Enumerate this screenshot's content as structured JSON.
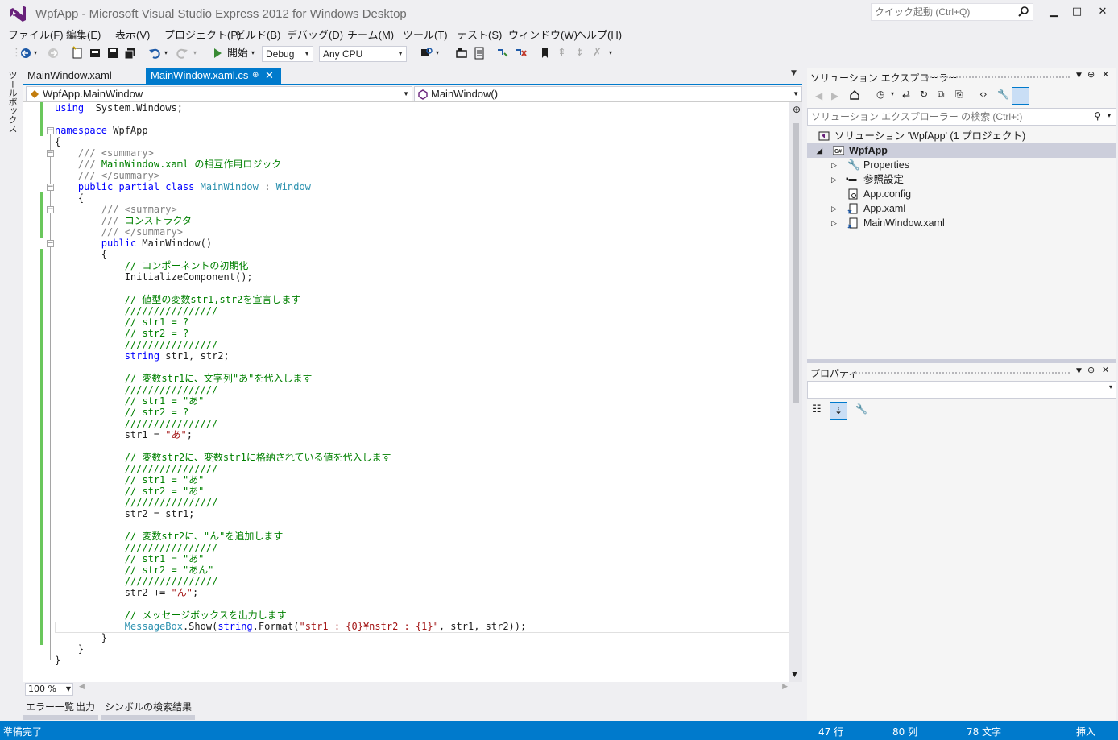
{
  "window": {
    "title": "WpfApp - Microsoft Visual Studio Express 2012 for Windows Desktop",
    "quick_launch_placeholder": "クイック起動 (Ctrl+Q)",
    "minimize": "▁",
    "maximize": "□",
    "close": "✕"
  },
  "menu": [
    "ファイル(F)",
    "編集(E)",
    "表示(V)",
    "プロジェクト(P)",
    "ビルド(B)",
    "デバッグ(D)",
    "チーム(M)",
    "ツール(T)",
    "テスト(S)",
    "ウィンドウ(W)",
    "ヘルプ(H)"
  ],
  "toolbar": {
    "start_label": "開始",
    "config": "Debug",
    "platform": "Any CPU"
  },
  "toolbox_label": "ツールボックス",
  "tabs": {
    "xaml": "MainWindow.xaml",
    "cs": "MainWindow.xaml.cs",
    "pin": "⊕",
    "close": "✕"
  },
  "nav": {
    "type": "WpfApp.MainWindow",
    "member": "MainWindow()"
  },
  "code_lines": [
    [
      [
        "kw",
        "using"
      ],
      [
        "",
        "  System.Windows;"
      ]
    ],
    [
      [
        "",
        ""
      ]
    ],
    [
      [
        "kw",
        "namespace"
      ],
      [
        "",
        " WpfApp"
      ]
    ],
    [
      [
        "",
        "{"
      ]
    ],
    [
      [
        "",
        "    "
      ],
      [
        "doc",
        "///"
      ],
      [
        "doc",
        " <summary>"
      ]
    ],
    [
      [
        "",
        "    "
      ],
      [
        "doc",
        "///"
      ],
      [
        "cm",
        " MainWindow.xaml の相互作用ロジック"
      ]
    ],
    [
      [
        "",
        "    "
      ],
      [
        "doc",
        "///"
      ],
      [
        "doc",
        " </summary>"
      ]
    ],
    [
      [
        "",
        "    "
      ],
      [
        "kw",
        "public partial class "
      ],
      [
        "ty",
        "MainWindow"
      ],
      [
        "",
        " : "
      ],
      [
        "ty",
        "Window"
      ]
    ],
    [
      [
        "",
        "    {"
      ]
    ],
    [
      [
        "",
        "        "
      ],
      [
        "doc",
        "///"
      ],
      [
        "doc",
        " <summary>"
      ]
    ],
    [
      [
        "",
        "        "
      ],
      [
        "doc",
        "///"
      ],
      [
        "cm",
        " コンストラクタ"
      ]
    ],
    [
      [
        "",
        "        "
      ],
      [
        "doc",
        "///"
      ],
      [
        "doc",
        " </summary>"
      ]
    ],
    [
      [
        "",
        "        "
      ],
      [
        "kw",
        "public"
      ],
      [
        "",
        " MainWindow()"
      ]
    ],
    [
      [
        "",
        "        {"
      ]
    ],
    [
      [
        "",
        "            "
      ],
      [
        "cm",
        "// コンポーネントの初期化"
      ]
    ],
    [
      [
        "",
        "            InitializeComponent();"
      ]
    ],
    [
      [
        "",
        ""
      ]
    ],
    [
      [
        "",
        "            "
      ],
      [
        "cm",
        "// 値型の変数str1,str2を宣言します"
      ]
    ],
    [
      [
        "",
        "            "
      ],
      [
        "cm",
        "////////////////"
      ]
    ],
    [
      [
        "",
        "            "
      ],
      [
        "cm",
        "// str1 = ?"
      ]
    ],
    [
      [
        "",
        "            "
      ],
      [
        "cm",
        "// str2 = ?"
      ]
    ],
    [
      [
        "",
        "            "
      ],
      [
        "cm",
        "////////////////"
      ]
    ],
    [
      [
        "",
        "            "
      ],
      [
        "kw",
        "string"
      ],
      [
        "",
        " str1, str2;"
      ]
    ],
    [
      [
        "",
        ""
      ]
    ],
    [
      [
        "",
        "            "
      ],
      [
        "cm",
        "// 変数str1に、文字列\"あ\"を代入します"
      ]
    ],
    [
      [
        "",
        "            "
      ],
      [
        "cm",
        "////////////////"
      ]
    ],
    [
      [
        "",
        "            "
      ],
      [
        "cm",
        "// str1 = \"あ\""
      ]
    ],
    [
      [
        "",
        "            "
      ],
      [
        "cm",
        "// str2 = ?"
      ]
    ],
    [
      [
        "",
        "            "
      ],
      [
        "cm",
        "////////////////"
      ]
    ],
    [
      [
        "",
        "            str1 = "
      ],
      [
        "st",
        "\"あ\""
      ],
      [
        "",
        ";"
      ]
    ],
    [
      [
        "",
        ""
      ]
    ],
    [
      [
        "",
        "            "
      ],
      [
        "cm",
        "// 変数str2に、変数str1に格納されている値を代入します"
      ]
    ],
    [
      [
        "",
        "            "
      ],
      [
        "cm",
        "////////////////"
      ]
    ],
    [
      [
        "",
        "            "
      ],
      [
        "cm",
        "// str1 = \"あ\""
      ]
    ],
    [
      [
        "",
        "            "
      ],
      [
        "cm",
        "// str2 = \"あ\""
      ]
    ],
    [
      [
        "",
        "            "
      ],
      [
        "cm",
        "////////////////"
      ]
    ],
    [
      [
        "",
        "            str2 = str1;"
      ]
    ],
    [
      [
        "",
        ""
      ]
    ],
    [
      [
        "",
        "            "
      ],
      [
        "cm",
        "// 変数str2に、\"ん\"を追加します"
      ]
    ],
    [
      [
        "",
        "            "
      ],
      [
        "cm",
        "////////////////"
      ]
    ],
    [
      [
        "",
        "            "
      ],
      [
        "cm",
        "// str1 = \"あ\""
      ]
    ],
    [
      [
        "",
        "            "
      ],
      [
        "cm",
        "// str2 = \"あん\""
      ]
    ],
    [
      [
        "",
        "            "
      ],
      [
        "cm",
        "////////////////"
      ]
    ],
    [
      [
        "",
        "            str2 += "
      ],
      [
        "st",
        "\"ん\""
      ],
      [
        "",
        ";"
      ]
    ],
    [
      [
        "",
        ""
      ]
    ],
    [
      [
        "",
        "            "
      ],
      [
        "cm",
        "// メッセージボックスを出力します"
      ]
    ],
    [
      [
        "",
        "            "
      ],
      [
        "ty",
        "MessageBox"
      ],
      [
        "",
        ".Show("
      ],
      [
        "kw",
        "string"
      ],
      [
        "",
        ".Format("
      ],
      [
        "st",
        "\"str1 : {0}¥nstr2 : {1}\""
      ],
      [
        "",
        ", str1, str2));"
      ]
    ],
    [
      [
        "",
        "        }"
      ]
    ],
    [
      [
        "",
        "    }"
      ]
    ],
    [
      [
        "",
        "}"
      ]
    ]
  ],
  "zoom": "100 %",
  "bottom_tabs": [
    "エラー一覧",
    "出力",
    "シンボルの検索結果"
  ],
  "status": {
    "ready": "準備完了",
    "line": "47 行",
    "col": "80 列",
    "char": "78 文字",
    "mode": "挿入"
  },
  "solution_explorer": {
    "title": "ソリューション エクスプローラー",
    "search_placeholder": "ソリューション エクスプローラー の検索 (Ctrl+:)",
    "solution": "ソリューション 'WpfApp' (1 プロジェクト)",
    "project": "WpfApp",
    "items": [
      "Properties",
      "参照設定",
      "App.config",
      "App.xaml",
      "MainWindow.xaml"
    ]
  },
  "properties": {
    "title": "プロパティ"
  },
  "colors": {
    "accent": "#007acc",
    "keyword": "#0000ff",
    "comment": "#008000",
    "type": "#2b91af",
    "string": "#a31515"
  }
}
